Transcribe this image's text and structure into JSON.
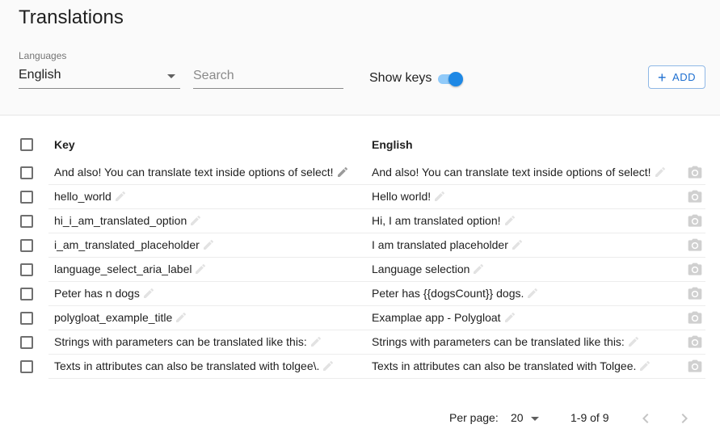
{
  "header": {
    "title": "Translations",
    "languages_label": "Languages",
    "language_selected": "English",
    "search_placeholder": "Search",
    "show_keys_label": "Show keys",
    "show_keys_on": true,
    "add_label": "ADD",
    "accent_color": "#1e88e5"
  },
  "table": {
    "columns": [
      "Key",
      "English"
    ],
    "rows": [
      {
        "key": "And also! You can translate text inside options of select!",
        "value": "And also! You can translate text inside options of select!"
      },
      {
        "key": "hello_world",
        "value": "Hello world!"
      },
      {
        "key": "hi_i_am_translated_option",
        "value": "Hi, I am translated option!"
      },
      {
        "key": "i_am_translated_placeholder",
        "value": "I am translated placeholder"
      },
      {
        "key": "language_select_aria_label",
        "value": "Language selection"
      },
      {
        "key": "Peter has n dogs",
        "value": "Peter has {{dogsCount}} dogs."
      },
      {
        "key": "polygloat_example_title",
        "value": "Examplae app - Polygloat"
      },
      {
        "key": "Strings with parameters can be translated like this:",
        "value": "Strings with parameters can be translated like this:"
      },
      {
        "key": "Texts in attributes can also be translated with tolgee\\.",
        "value": "Texts in attributes can also be translated with Tolgee."
      }
    ]
  },
  "pagination": {
    "per_page_label": "Per page:",
    "per_page_value": "20",
    "range": "1-9 of 9"
  },
  "icons": {
    "edit": "pencil-icon",
    "screenshot": "camera-icon",
    "prev": "chevron-left-icon",
    "next": "chevron-right-icon",
    "add": "plus-icon"
  }
}
